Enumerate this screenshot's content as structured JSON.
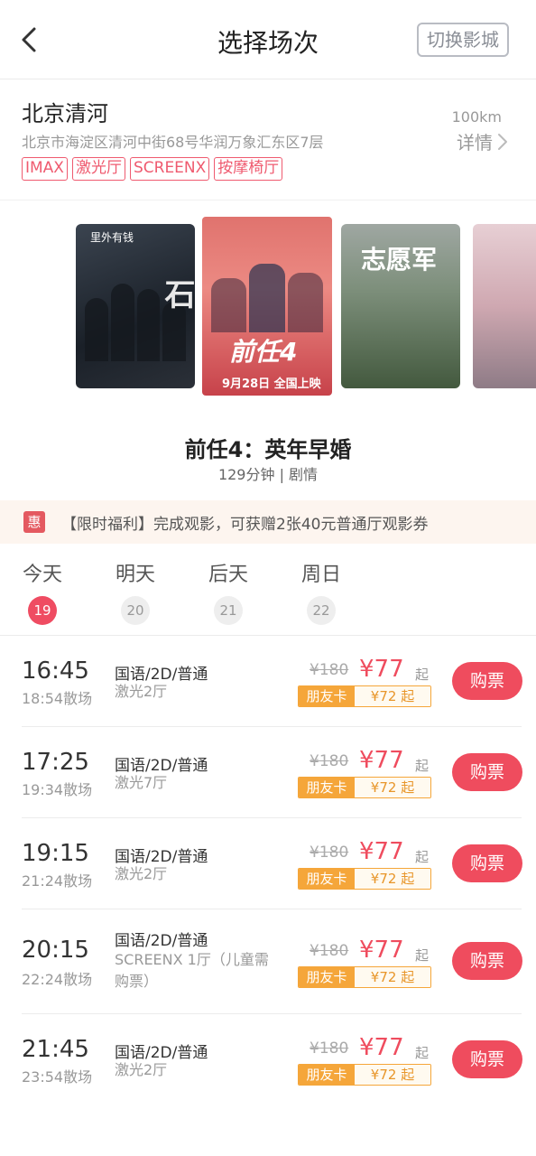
{
  "header": {
    "title": "选择场次",
    "switch_label": "切换影城"
  },
  "cinema": {
    "name": "北京清河",
    "address": "北京市海淀区清河中街68号华润万象汇东区7层",
    "distance": "100km",
    "detail_label": "详情",
    "tags": [
      "IMAX",
      "激光厅",
      "SCREENX",
      "按摩椅厅"
    ]
  },
  "posters": {
    "p1_title": "里外有钱",
    "p1_big": "坚如磐石",
    "p2_tagline": "前任4",
    "p2_date": "9月28日 全国上映",
    "p3_big": "志愿军"
  },
  "movie": {
    "title": "前任4：英年早婚",
    "meta": "129分钟 | 剧情"
  },
  "promo": {
    "badge": "惠",
    "text": "【限时福利】完成观影，可获赠2张40元普通厅观影券"
  },
  "dates": [
    {
      "label": "今天",
      "num": "19"
    },
    {
      "label": "明天",
      "num": "20"
    },
    {
      "label": "后天",
      "num": "21"
    },
    {
      "label": "周日",
      "num": "22"
    }
  ],
  "shows": [
    {
      "start": "16:45",
      "end": "18:54散场",
      "lang": "国语/2D/普通",
      "hall": "激光2厅",
      "orig": "¥180",
      "price": "¥77",
      "qi": "起",
      "card_label": "朋友卡",
      "card_price": "¥72 起",
      "buy": "购票"
    },
    {
      "start": "17:25",
      "end": "19:34散场",
      "lang": "国语/2D/普通",
      "hall": "激光7厅",
      "orig": "¥180",
      "price": "¥77",
      "qi": "起",
      "card_label": "朋友卡",
      "card_price": "¥72 起",
      "buy": "购票"
    },
    {
      "start": "19:15",
      "end": "21:24散场",
      "lang": "国语/2D/普通",
      "hall": "激光2厅",
      "orig": "¥180",
      "price": "¥77",
      "qi": "起",
      "card_label": "朋友卡",
      "card_price": "¥72 起",
      "buy": "购票"
    },
    {
      "start": "20:15",
      "end": "22:24散场",
      "lang": "国语/2D/普通",
      "hall": "SCREENX 1厅（儿童需购票）",
      "orig": "¥180",
      "price": "¥77",
      "qi": "起",
      "card_label": "朋友卡",
      "card_price": "¥72 起",
      "buy": "购票"
    },
    {
      "start": "21:45",
      "end": "23:54散场",
      "lang": "国语/2D/普通",
      "hall": "激光2厅",
      "orig": "¥180",
      "price": "¥77",
      "qi": "起",
      "card_label": "朋友卡",
      "card_price": "¥72 起",
      "buy": "购票"
    }
  ],
  "colors": {
    "accent": "#ef4c5e",
    "card": "#f5a63a",
    "promo_bg": "#fdf5ef"
  },
  "icons": {
    "back": "chevron-left-icon",
    "detail": "chevron-right-icon"
  }
}
